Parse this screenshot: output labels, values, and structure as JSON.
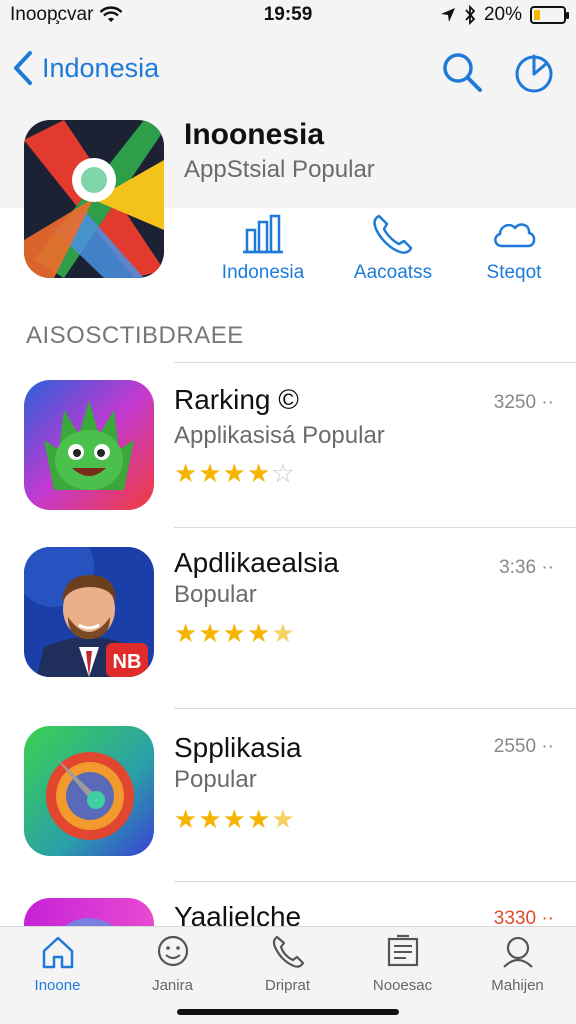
{
  "status": {
    "carrier": "Inoop̧cvar",
    "time": "19:59",
    "battery": "20%",
    "battery_level": 0.2
  },
  "nav": {
    "back_label": "Indonesia"
  },
  "hero": {
    "title": "Inoonesia",
    "subtitle": "AppStsial Popular"
  },
  "actions": [
    {
      "label": "Indonesia",
      "icon": "chart-icon"
    },
    {
      "label": "Aacoatss",
      "icon": "phone-icon"
    },
    {
      "label": "Steqot",
      "icon": "cloud-icon"
    }
  ],
  "section": {
    "title": "AISOSCTIBDRAEE"
  },
  "apps": [
    {
      "title": "Rarking ©",
      "subtitle": "Applikasisá Popular",
      "rating": 4,
      "price": "3250 ··",
      "price_color": "#888888"
    },
    {
      "title": "Apdlikaealsia",
      "subtitle": "Bopular",
      "rating": 4.5,
      "price": "3:36 ··",
      "price_color": "#888888"
    },
    {
      "title": "Spplikasia",
      "subtitle": "Popular",
      "rating": 4.5,
      "price": "2550 ··",
      "price_color": "#888888"
    },
    {
      "title": "Yaalielche",
      "subtitle": "",
      "rating": 0,
      "price": "3330 ··",
      "price_color": "#e04a2a"
    }
  ],
  "tabs": [
    {
      "label": "Inoone",
      "icon": "home-icon",
      "active": true
    },
    {
      "label": "Janira",
      "icon": "face-icon",
      "active": false
    },
    {
      "label": "Driprat",
      "icon": "phone-icon",
      "active": false
    },
    {
      "label": "Nooesac",
      "icon": "document-icon",
      "active": false
    },
    {
      "label": "Mahijen",
      "icon": "profile-icon",
      "active": false
    }
  ],
  "colors": {
    "accent": "#1e7ad8",
    "star": "#f4b400",
    "bar_bg": "#f4f4f4"
  }
}
